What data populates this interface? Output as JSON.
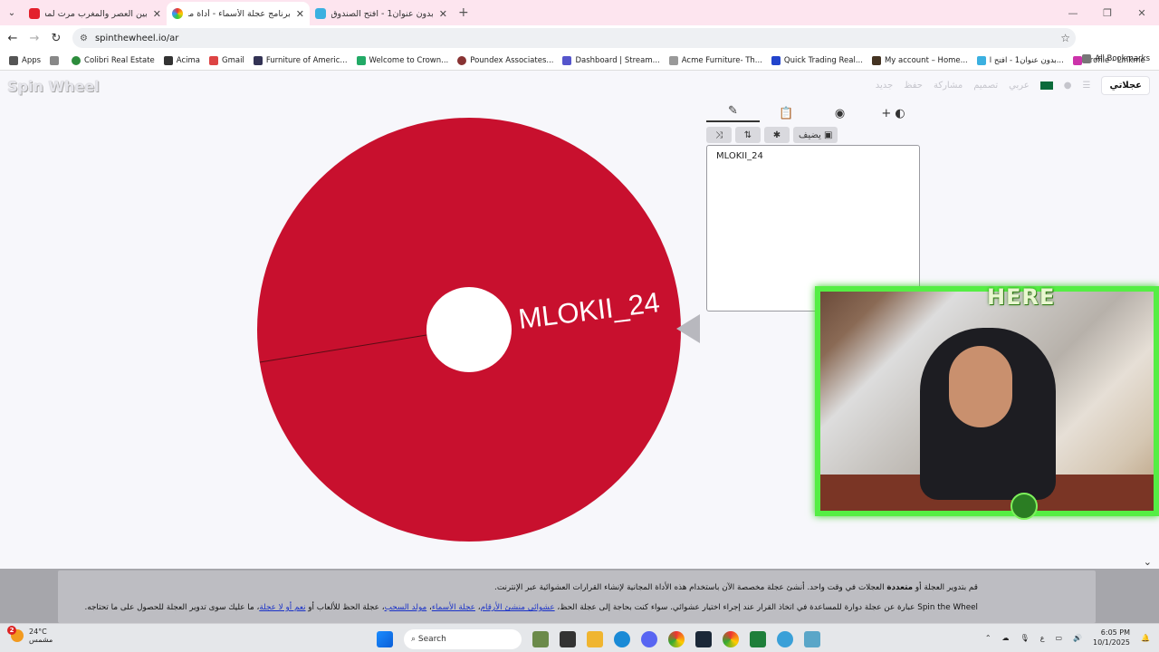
{
  "browser": {
    "tabs": [
      {
        "title": "بين العصر والمغرب مرت لمه خيال",
        "color": "#e3202c"
      },
      {
        "title": "برنامج عجلة الأسماء - أداة مخصصة",
        "color": "#f4b400"
      },
      {
        "title": "بدون عنوان1 - افتح الصندوق",
        "color": "#3bb0e0"
      }
    ],
    "url": "spinthewheel.io/ar",
    "bookmarks": [
      "Apps",
      "Colibri Real Estate",
      "Acima",
      "Gmail",
      "Furniture of Americ...",
      "Welcome to Crown...",
      "Poundex Associates...",
      "Dashboard | Stream...",
      "Acme Furniture- Th...",
      "Quick Trading Real...",
      "My account – Home...",
      "بدون عنوان1 - افتح ا...",
      "Profile - Linkme"
    ],
    "all_bookmarks": "All Bookmarks"
  },
  "site": {
    "logo": "Spin Wheel",
    "my_wheels": "عجلاتي",
    "nav": [
      "جديد",
      "حفظ",
      "مشاركة",
      "تصميم",
      "عربي"
    ]
  },
  "wheel": {
    "segments": [
      {
        "label": "MLOKII_24",
        "color": "#c8102e"
      }
    ]
  },
  "editor": {
    "add_image_label": "يضيف",
    "entries_text": "MLOKII_24"
  },
  "overlay": {
    "here_text": "HERE"
  },
  "footer": {
    "line1_part1": "قم بتدوير العجلة أو ",
    "line1_bold": "متعددة",
    "line1_part2": " العجلات في وقت واحد. أنشئ عجلة مخصصة الآن باستخدام هذه الأداة المجانية لإنشاء القرارات العشوائية عبر الإنترنت.",
    "line2_part1": "Spin the Wheel عبارة عن عجلة دوارة للمساعدة في اتخاذ القرار عند إجراء اختيار عشوائي. سواء كنت بحاجة إلى عجلة الحظ، ",
    "link1": "عشوائي منشئ الأرقام",
    "link2": "عجلة الأسماء",
    "link3": "مولد السحب",
    "line2_part2": "، عجلة الحظ للألعاب أو ",
    "link4": "نعم أو لا عجلة",
    "line2_part3": "، ما عليك سوى تدوير العجلة للحصول على ما تحتاجه."
  },
  "taskbar": {
    "temp": "24°C",
    "weather": "مشمس",
    "search": "Search",
    "time": "6:05 PM",
    "date": "10/1/2025",
    "lang": "ع",
    "badge_count": "2"
  }
}
